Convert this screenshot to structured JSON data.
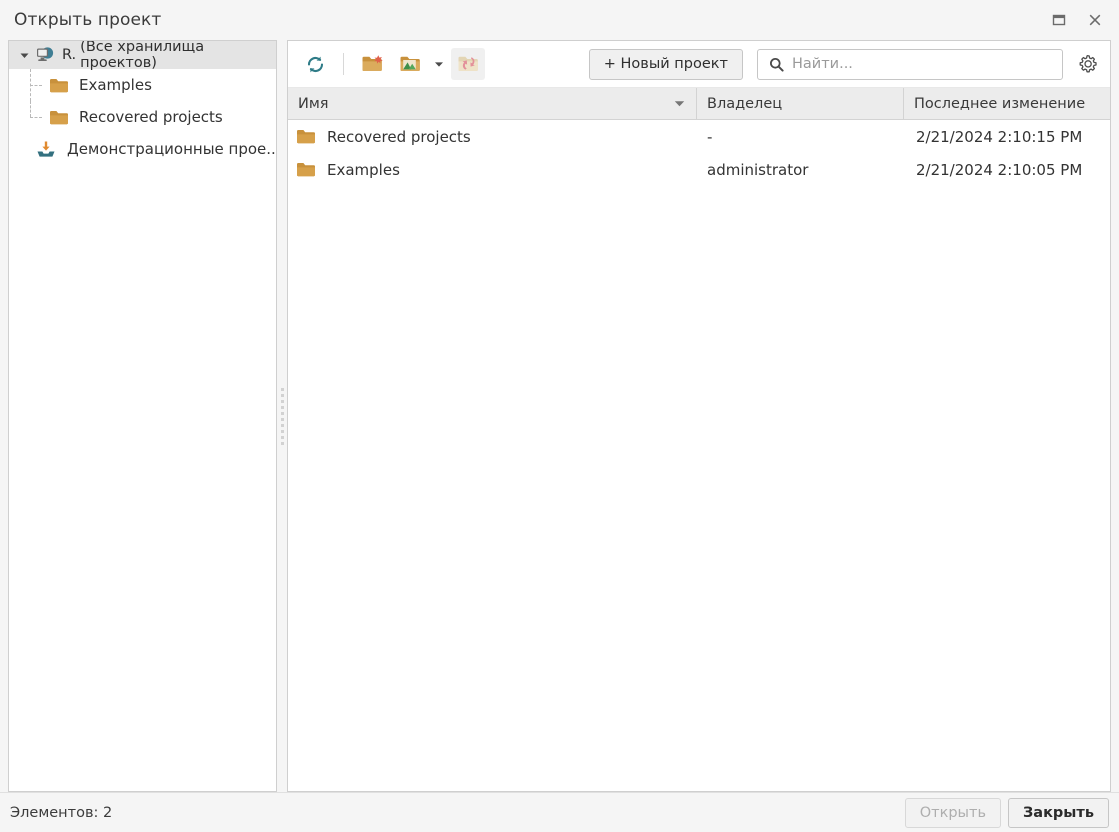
{
  "window": {
    "title": "Открыть проект",
    "maximize_icon": "maximize-icon",
    "close_icon": "close-icon"
  },
  "sidebar": {
    "root": {
      "label": "R.",
      "sub_label": "(Все хранилища проектов)",
      "icon": "server-icon",
      "expanded": true
    },
    "children": [
      {
        "label": "Examples",
        "icon": "folder-icon"
      },
      {
        "label": "Recovered projects",
        "icon": "folder-icon"
      }
    ],
    "leaves": [
      {
        "label": "Демонстрационные прое...",
        "icon": "demo-import-icon"
      }
    ]
  },
  "toolbar": {
    "refresh_icon": "refresh-icon",
    "new_folder_icon": "new-folder-icon",
    "import_folder_icon": "import-folder-icon",
    "import_dropdown_icon": "chevron-down-icon",
    "restore_folder_icon": "restore-folder-icon",
    "new_project_label": "+ Новый проект",
    "settings_icon": "gear-icon"
  },
  "search": {
    "placeholder": "Найти...",
    "value": "",
    "icon": "search-icon"
  },
  "table": {
    "columns": [
      {
        "key": "name",
        "label": "Имя",
        "sorted": true,
        "sort_icon": "sort-descending-icon"
      },
      {
        "key": "owner",
        "label": "Владелец"
      },
      {
        "key": "modified",
        "label": "Последнее изменение"
      }
    ],
    "rows": [
      {
        "icon": "folder-icon",
        "name": "Recovered projects",
        "owner": "-",
        "modified": "2/21/2024 2:10:15 PM"
      },
      {
        "icon": "folder-icon",
        "name": "Examples",
        "owner": "administrator",
        "modified": "2/21/2024 2:10:05 PM"
      }
    ]
  },
  "statusbar": {
    "items_label": "Элементов: 2",
    "open_button": "Открыть",
    "close_button": "Закрыть"
  },
  "colors": {
    "folder": "#c8913c",
    "accent_teal": "#2e7b87",
    "window_bg": "#f5f5f5",
    "panel_bg": "#ffffff",
    "header_bg": "#ececec",
    "selection_bg": "#e4e4e4"
  }
}
